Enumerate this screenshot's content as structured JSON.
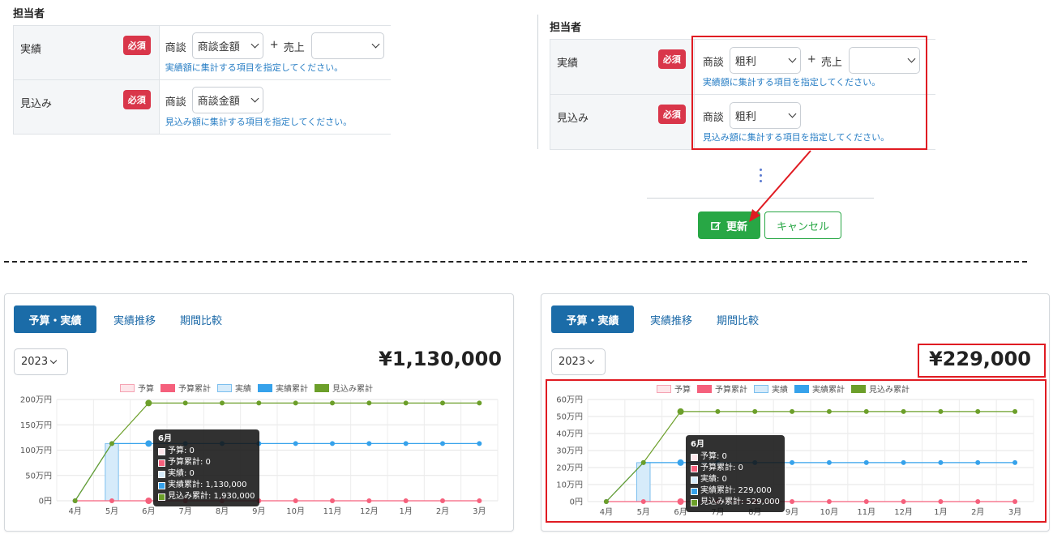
{
  "form_left": {
    "section_title": "担当者",
    "rows": [
      {
        "label": "実績",
        "badge": "必須",
        "prefix": "商談",
        "select1": "商談金額",
        "plus": "+",
        "label2": "売上",
        "select2": "",
        "hint": "実績額に集計する項目を指定してください。"
      },
      {
        "label": "見込み",
        "badge": "必須",
        "prefix": "商談",
        "select1": "商談金額",
        "hint": "見込み額に集計する項目を指定してください。"
      }
    ]
  },
  "form_right": {
    "section_title": "担当者",
    "rows": [
      {
        "label": "実績",
        "badge": "必須",
        "prefix": "商談",
        "select1": "粗利",
        "plus": "+",
        "label2": "売上",
        "select2": "",
        "hint": "実績額に集計する項目を指定してください。"
      },
      {
        "label": "見込み",
        "badge": "必須",
        "prefix": "商談",
        "select1": "粗利",
        "hint": "見込み額に集計する項目を指定してください。"
      }
    ],
    "update_button": "更新",
    "cancel_button": "キャンセル"
  },
  "colors": {
    "accent_red": "#e01b22",
    "primary_blue": "#1b6ca8",
    "green": "#28a745",
    "badge_red": "#d9364a"
  },
  "card_left": {
    "tabs": [
      "予算・実績",
      "実績推移",
      "期間比較"
    ],
    "year": "2023",
    "total": "¥1,130,000",
    "legend": [
      "予算",
      "予算累計",
      "実績",
      "実績累計",
      "見込み累計"
    ],
    "tooltip": {
      "title": "6月",
      "lines": [
        "予算: 0",
        "予算累計: 0",
        "実績: 0",
        "実績累計: 1,130,000",
        "見込み累計: 1,930,000"
      ]
    }
  },
  "card_right": {
    "tabs": [
      "予算・実績",
      "実績推移",
      "期間比較"
    ],
    "year": "2023",
    "total": "¥229,000",
    "legend": [
      "予算",
      "予算累計",
      "実績",
      "実績累計",
      "見込み累計"
    ],
    "tooltip": {
      "title": "6月",
      "lines": [
        "予算: 0",
        "予算累計: 0",
        "実績: 0",
        "実績累計: 229,000",
        "見込み累計: 529,000"
      ]
    }
  },
  "chart_data": [
    {
      "type": "bar",
      "categories": [
        "4月",
        "5月",
        "6月",
        "7月",
        "8月",
        "9月",
        "10月",
        "11月",
        "12月",
        "1月",
        "2月",
        "3月"
      ],
      "y_tick_labels": [
        "0円",
        "50万円",
        "100万円",
        "150万円",
        "200万円"
      ],
      "ylim": [
        0,
        2000000
      ],
      "series": [
        {
          "name": "予算",
          "kind": "bar",
          "values": [
            0,
            0,
            0,
            0,
            0,
            0,
            0,
            0,
            0,
            0,
            0,
            0
          ]
        },
        {
          "name": "予算累計",
          "kind": "line",
          "values": [
            0,
            0,
            0,
            0,
            0,
            0,
            0,
            0,
            0,
            0,
            0,
            0
          ]
        },
        {
          "name": "実績",
          "kind": "bar",
          "values": [
            0,
            1130000,
            0,
            0,
            0,
            0,
            0,
            0,
            0,
            0,
            0,
            0
          ]
        },
        {
          "name": "実績累計",
          "kind": "line",
          "values": [
            0,
            1130000,
            1130000,
            1130000,
            1130000,
            1130000,
            1130000,
            1130000,
            1130000,
            1130000,
            1130000,
            1130000
          ]
        },
        {
          "name": "見込み累計",
          "kind": "line",
          "values": [
            0,
            1130000,
            1930000,
            1930000,
            1930000,
            1930000,
            1930000,
            1930000,
            1930000,
            1930000,
            1930000,
            1930000
          ]
        }
      ],
      "legend_position": "top",
      "grid": true
    },
    {
      "type": "bar",
      "categories": [
        "4月",
        "5月",
        "6月",
        "7月",
        "8月",
        "9月",
        "10月",
        "11月",
        "12月",
        "1月",
        "2月",
        "3月"
      ],
      "y_tick_labels": [
        "0円",
        "10万円",
        "20万円",
        "30万円",
        "40万円",
        "50万円",
        "60万円"
      ],
      "ylim": [
        0,
        600000
      ],
      "series": [
        {
          "name": "予算",
          "kind": "bar",
          "values": [
            0,
            0,
            0,
            0,
            0,
            0,
            0,
            0,
            0,
            0,
            0,
            0
          ]
        },
        {
          "name": "予算累計",
          "kind": "line",
          "values": [
            0,
            0,
            0,
            0,
            0,
            0,
            0,
            0,
            0,
            0,
            0,
            0
          ]
        },
        {
          "name": "実績",
          "kind": "bar",
          "values": [
            0,
            229000,
            0,
            0,
            0,
            0,
            0,
            0,
            0,
            0,
            0,
            0
          ]
        },
        {
          "name": "実績累計",
          "kind": "line",
          "values": [
            0,
            229000,
            229000,
            229000,
            229000,
            229000,
            229000,
            229000,
            229000,
            229000,
            229000,
            229000
          ]
        },
        {
          "name": "見込み累計",
          "kind": "line",
          "values": [
            0,
            229000,
            529000,
            529000,
            529000,
            529000,
            529000,
            529000,
            529000,
            529000,
            529000,
            529000
          ]
        }
      ],
      "legend_position": "top",
      "grid": true
    }
  ]
}
